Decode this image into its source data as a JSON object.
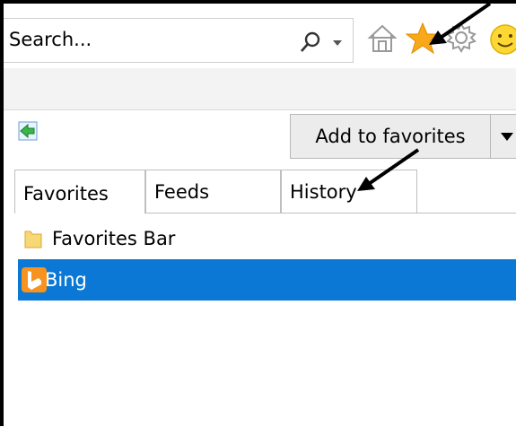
{
  "toolbar": {
    "search_placeholder": "Search...",
    "icons": [
      "search-icon",
      "chevron-down-icon",
      "home-icon",
      "star-icon",
      "gear-icon",
      "smiley-icon"
    ]
  },
  "favorites_panel": {
    "add_button_label": "Add to favorites",
    "tabs": [
      {
        "label": "Favorites"
      },
      {
        "label": "Feeds"
      },
      {
        "label": "History"
      }
    ],
    "items": [
      {
        "label": "Favorites Bar",
        "icon": "folder-icon"
      },
      {
        "label": "Bing",
        "icon": "bing-icon"
      }
    ]
  },
  "colors": {
    "selection": "#0a78d4",
    "star": "#f7a81b",
    "back_arrow": "#39b54a"
  }
}
